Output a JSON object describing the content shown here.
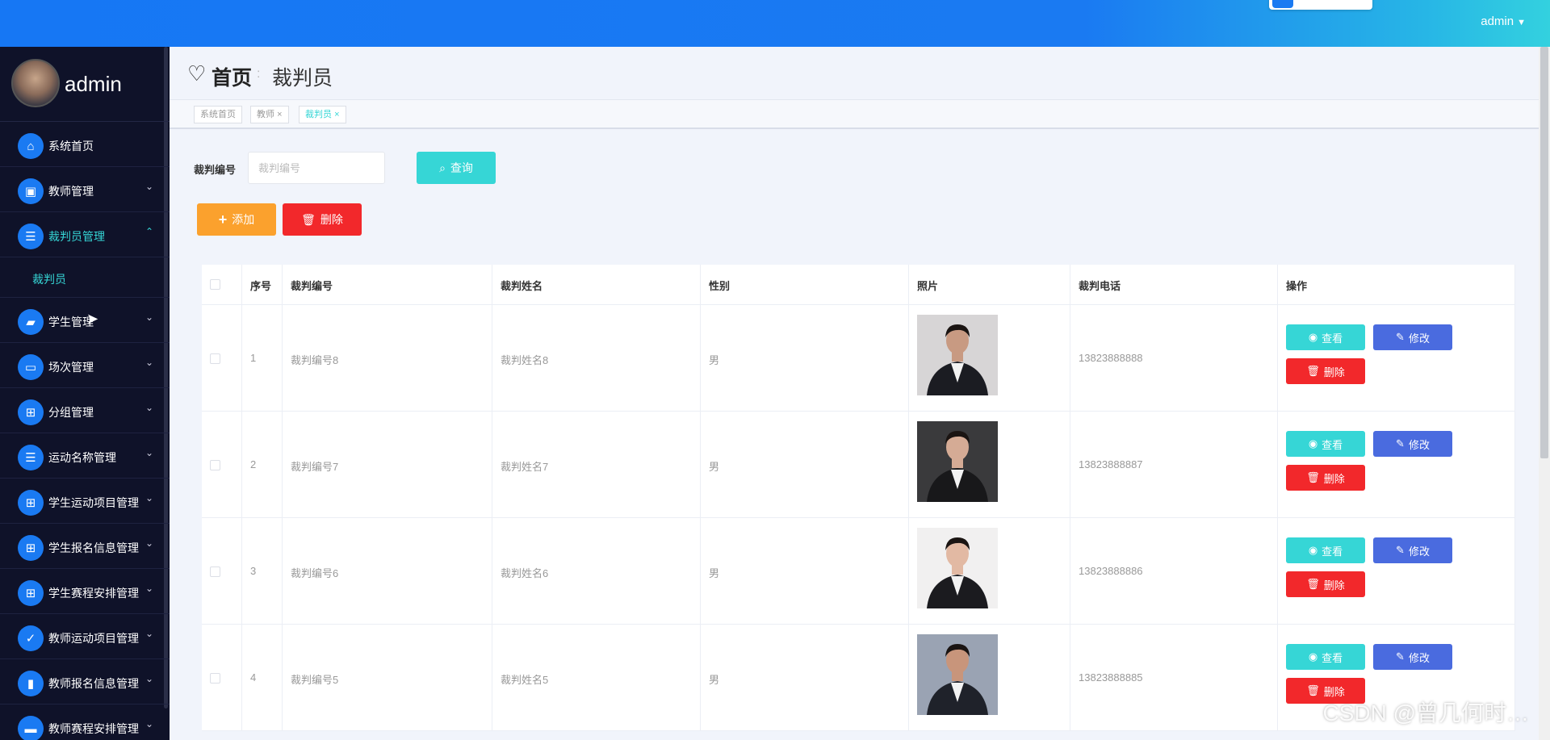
{
  "header": {
    "username": "admin"
  },
  "sidebar": {
    "username": "admin",
    "items": [
      {
        "label": "系统首页",
        "icon": "home-icon",
        "glyph": "⌂",
        "arrow": ""
      },
      {
        "label": "教师管理",
        "icon": "briefcase-icon",
        "glyph": "▣",
        "arrow": "⌄"
      },
      {
        "label": "裁判员管理",
        "icon": "sliders-icon",
        "glyph": "☰",
        "arrow": "⌃"
      },
      {
        "label": "学生管理",
        "icon": "folder-icon",
        "glyph": "▰",
        "arrow": "⌄"
      },
      {
        "label": "场次管理",
        "icon": "monitor-icon",
        "glyph": "▭",
        "arrow": "⌄"
      },
      {
        "label": "分组管理",
        "icon": "grid-icon",
        "glyph": "⊞",
        "arrow": "⌄"
      },
      {
        "label": "运动名称管理",
        "icon": "list-icon",
        "glyph": "☰",
        "arrow": "⌄"
      },
      {
        "label": "学生运动项目管理",
        "icon": "grid-icon",
        "glyph": "⊞",
        "arrow": "⌄"
      },
      {
        "label": "学生报名信息管理",
        "icon": "grid-icon",
        "glyph": "⊞",
        "arrow": "⌄"
      },
      {
        "label": "学生赛程安排管理",
        "icon": "grid-icon",
        "glyph": "⊞",
        "arrow": "⌄"
      },
      {
        "label": "教师运动项目管理",
        "icon": "clipboard-icon",
        "glyph": "✓",
        "arrow": "⌄"
      },
      {
        "label": "教师报名信息管理",
        "icon": "book-icon",
        "glyph": "▮",
        "arrow": "⌄"
      },
      {
        "label": "教师赛程安排管理",
        "icon": "ticket-icon",
        "glyph": "▬",
        "arrow": "⌄"
      }
    ],
    "submenu": "裁判员"
  },
  "breadcrumb": {
    "home": "首页",
    "current": "裁判员"
  },
  "tags": [
    "系统首页",
    "教师",
    "裁判员"
  ],
  "search": {
    "label": "裁判编号",
    "placeholder": "裁判编号",
    "button": "查询"
  },
  "toolbar": {
    "add": "添加",
    "delete": "删除"
  },
  "table": {
    "columns": [
      "序号",
      "裁判编号",
      "裁判姓名",
      "性别",
      "照片",
      "裁判电话",
      "操作"
    ],
    "rows": [
      {
        "index": "1",
        "code": "裁判编号8",
        "name": "裁判姓名8",
        "gender": "男",
        "phone": "13823888888",
        "photo_bg": "#d7d5d6",
        "suit": "#1b1c22",
        "skin": "#c89a82"
      },
      {
        "index": "2",
        "code": "裁判编号7",
        "name": "裁判姓名7",
        "gender": "男",
        "phone": "13823888887",
        "photo_bg": "#3a3a3c",
        "suit": "#18181a",
        "skin": "#d5ab95"
      },
      {
        "index": "3",
        "code": "裁判编号6",
        "name": "裁判姓名6",
        "gender": "男",
        "phone": "13823888886",
        "photo_bg": "#f1f0f0",
        "suit": "#1b1b1f",
        "skin": "#e2b9a3"
      },
      {
        "index": "4",
        "code": "裁判编号5",
        "name": "裁判姓名5",
        "gender": "男",
        "phone": "13823888885",
        "photo_bg": "#9aa3b3",
        "suit": "#1f222a",
        "skin": "#c8957b"
      }
    ],
    "actions": {
      "view": "查看",
      "edit": "修改",
      "delete": "删除"
    }
  },
  "watermark": "CSDN @曾几何时…",
  "colors": {
    "accent": "#36d6d6",
    "primary": "#1a7af2",
    "danger": "#f2282b",
    "warning": "#fba12d",
    "edit": "#4a6bdf",
    "sidebar": "#0f1229"
  }
}
